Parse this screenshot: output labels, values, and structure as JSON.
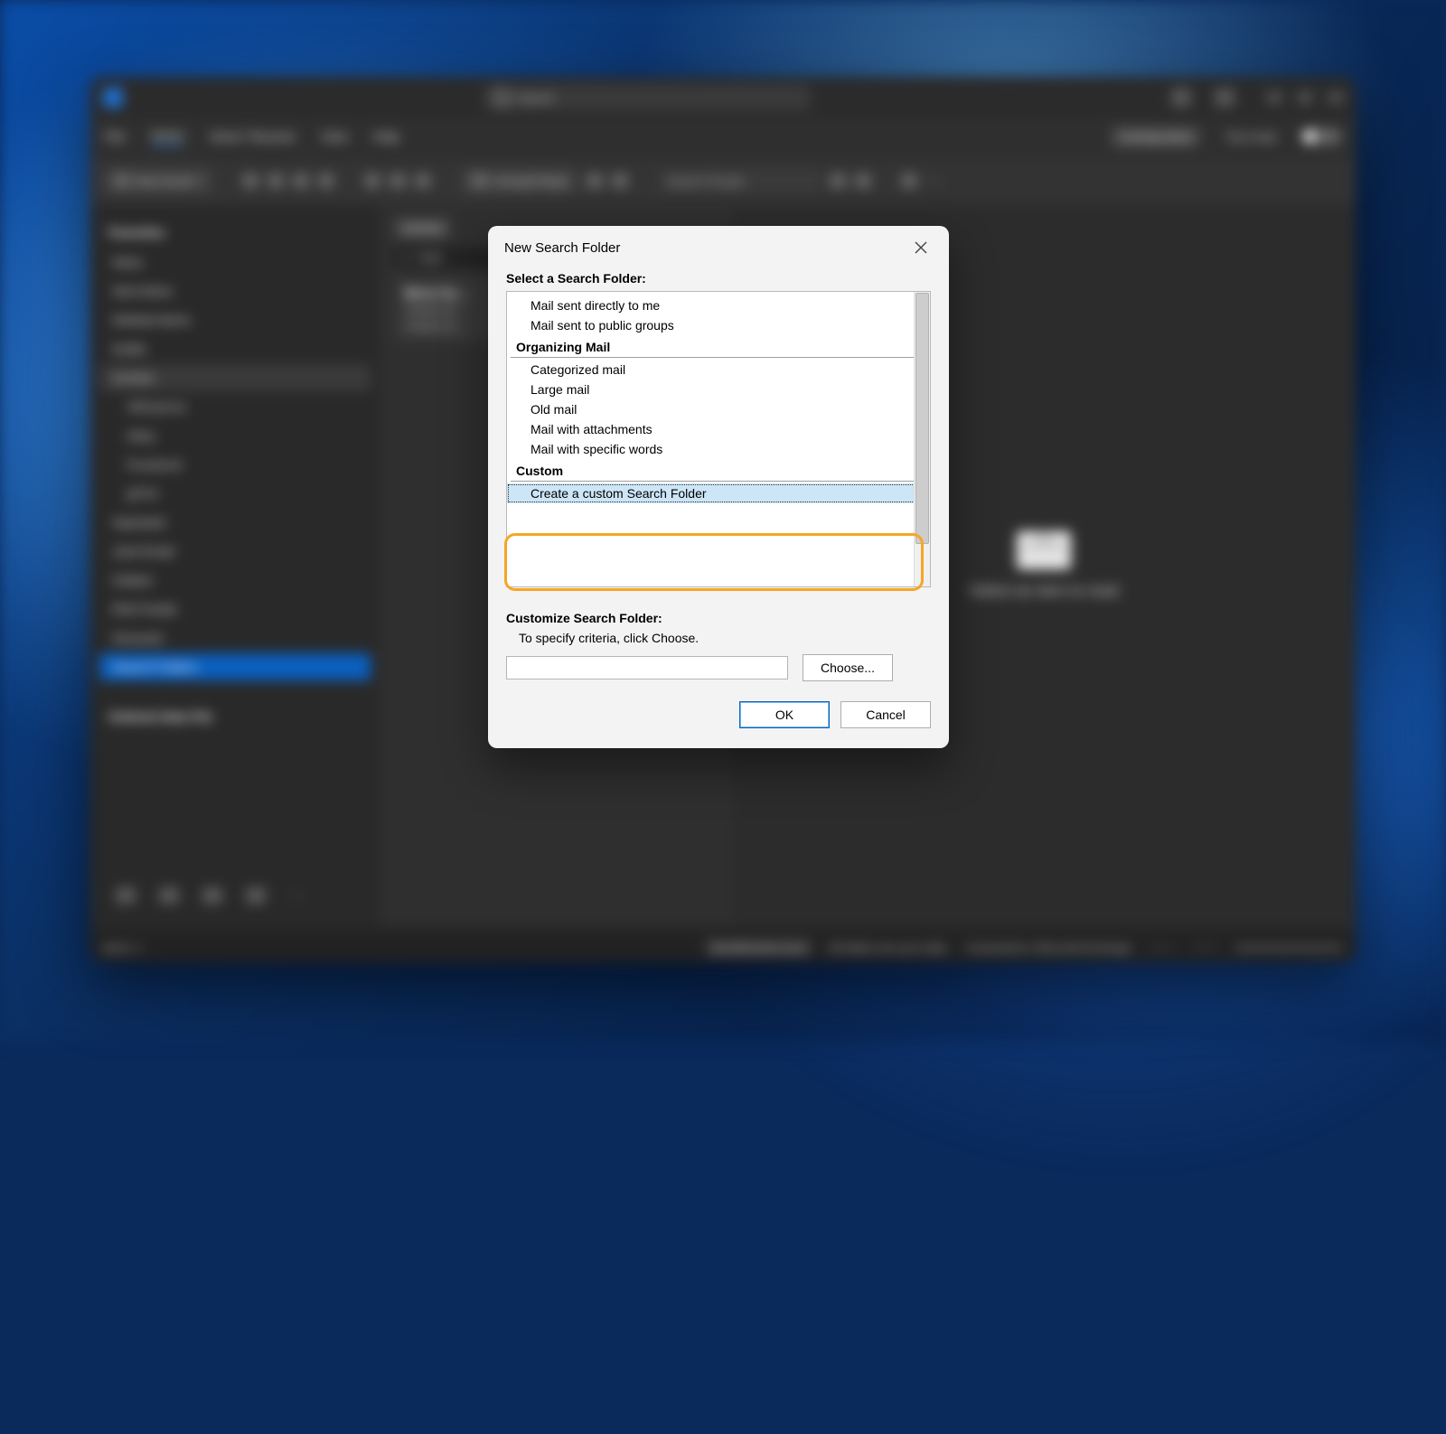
{
  "app": {
    "search_placeholder": "Search",
    "menubar": {
      "file": "File",
      "home": "Home",
      "sendreceive": "Send / Receive",
      "view": "View",
      "help": "Help",
      "comingsoon": "Coming Soon",
      "tryitnow": "Try it now"
    },
    "ribbon": {
      "new_email": "New Email",
      "unread_read": "Unread/ Read",
      "search_people": "Search People"
    },
    "nav": {
      "favorites": "Favorites",
      "inbox": "Inbox",
      "sent": "Sent Items",
      "deleted": "Deleted Items",
      "drafts": "Drafts",
      "archive": "Archive",
      "sub_aliexpress": "AliExpress",
      "sub_ebay": "eBay",
      "sub_facebook": "Facebook",
      "sub_gfss": "gFSS",
      "important": "Important",
      "junk": "Junk Email",
      "outbox": "Outbox",
      "rss": "RSS Feeds",
      "snoozed": "Snoozed",
      "search_folders": "Search Folders",
      "data_file": "Outlook Data File"
    },
    "list": {
      "tab_archive": "Archive",
      "sort_older": "Older",
      "msg_title": "Move Su…",
      "msg_line1": "Thanks for…",
      "msg_line2": "Thanks for…"
    },
    "reading": {
      "placeholder": "Select an item to read"
    },
    "status": {
      "items": "Items: 1",
      "sr_error": "Send/Receive error",
      "uptodate": "All folders are up to date.",
      "connected": "Connected to: Microsoft Exchange"
    }
  },
  "dialog": {
    "title": "New Search Folder",
    "select_label": "Select a Search Folder:",
    "items": {
      "directly_to_me": "Mail sent directly to me",
      "public_groups": "Mail sent to public groups",
      "organizing_header": "Organizing Mail",
      "categorized": "Categorized mail",
      "large": "Large mail",
      "old": "Old mail",
      "attachments": "Mail with attachments",
      "specific_words": "Mail with specific words",
      "custom_header": "Custom",
      "create_custom": "Create a custom Search Folder"
    },
    "customize_label": "Customize Search Folder:",
    "instruction": "To specify criteria, click Choose.",
    "choose": "Choose...",
    "ok": "OK",
    "cancel": "Cancel"
  }
}
